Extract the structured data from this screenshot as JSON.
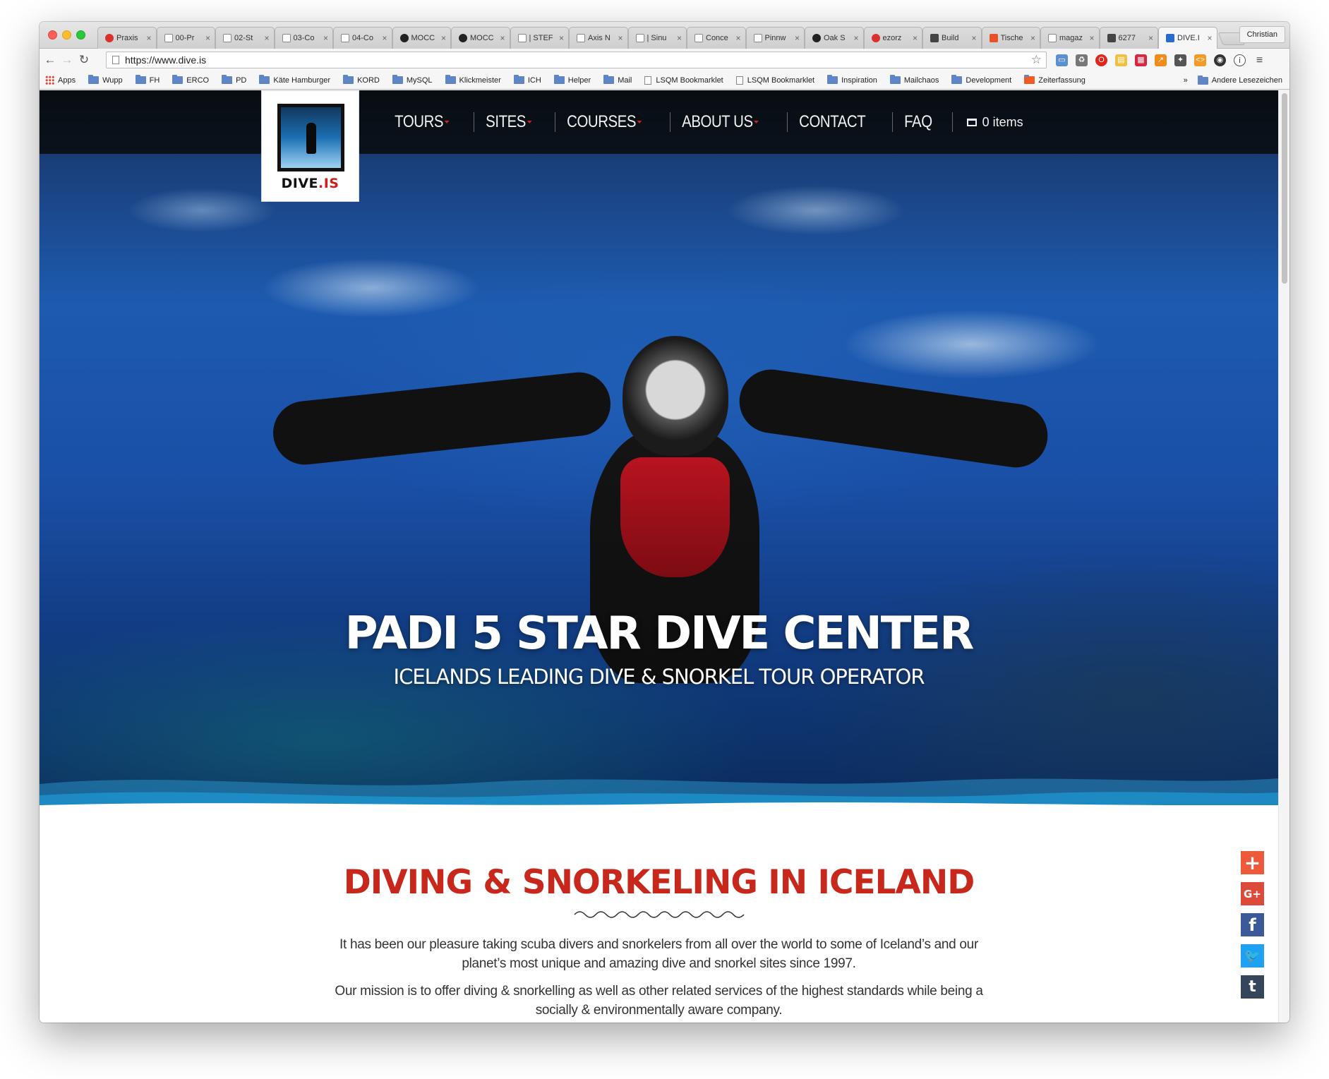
{
  "browser": {
    "tabs": [
      {
        "label": "Praxis",
        "icon": "pinterest-icon"
      },
      {
        "label": "00-Pr",
        "icon": "document-icon"
      },
      {
        "label": "02-St",
        "icon": "document-icon"
      },
      {
        "label": "03-Co",
        "icon": "document-icon"
      },
      {
        "label": "04-Co",
        "icon": "document-icon"
      },
      {
        "label": "MOCC",
        "icon": "circle-icon"
      },
      {
        "label": "MOCC",
        "icon": "circle-icon"
      },
      {
        "label": "| STEF",
        "icon": "document-icon"
      },
      {
        "label": "Axis N",
        "icon": "document-icon"
      },
      {
        "label": "| Sinu",
        "icon": "document-icon"
      },
      {
        "label": "Conce",
        "icon": "document-icon"
      },
      {
        "label": "Pinnw",
        "icon": "document-icon"
      },
      {
        "label": "Oak S",
        "icon": "o-icon"
      },
      {
        "label": "ezorz",
        "icon": "red-circle-icon"
      },
      {
        "label": "Build",
        "icon": "layers-icon"
      },
      {
        "label": "Tische",
        "icon": "orange-icon"
      },
      {
        "label": "magaz",
        "icon": "google-icon"
      },
      {
        "label": "6277",
        "icon": "dark-icon"
      },
      {
        "label": "DIVE.I",
        "icon": "dive-icon"
      }
    ],
    "profile_name": "Christian",
    "url": "https://www.dive.is",
    "bookmarks": [
      {
        "label": "Apps",
        "type": "apps"
      },
      {
        "label": "Wupp",
        "type": "folder"
      },
      {
        "label": "FH",
        "type": "folder"
      },
      {
        "label": "ERCO",
        "type": "folder"
      },
      {
        "label": "PD",
        "type": "folder"
      },
      {
        "label": "Käte Hamburger",
        "type": "folder"
      },
      {
        "label": "KORD",
        "type": "folder"
      },
      {
        "label": "MySQL",
        "type": "folder"
      },
      {
        "label": "Klickmeister",
        "type": "folder"
      },
      {
        "label": "ICH",
        "type": "folder"
      },
      {
        "label": "Helper",
        "type": "folder"
      },
      {
        "label": "Mail",
        "type": "folder"
      },
      {
        "label": "LSQM Bookmarklet",
        "type": "page"
      },
      {
        "label": "LSQM Bookmarklet",
        "type": "page"
      },
      {
        "label": "Inspiration",
        "type": "folder"
      },
      {
        "label": "Mailchaos",
        "type": "folder"
      },
      {
        "label": "Development",
        "type": "folder"
      },
      {
        "label": "Zeiterfassung",
        "type": "app"
      }
    ],
    "bookmarks_overflow": "»",
    "other_bookmarks": "Andere Lesezeichen"
  },
  "site": {
    "logo_text": "DIVE",
    "logo_suffix": ".IS",
    "nav": [
      {
        "label": "TOURS",
        "dropdown": true
      },
      {
        "label": "SITES",
        "dropdown": true
      },
      {
        "label": "COURSES",
        "dropdown": true
      },
      {
        "label": "ABOUT US",
        "dropdown": true
      },
      {
        "label": "CONTACT",
        "dropdown": false
      },
      {
        "label": "FAQ",
        "dropdown": false
      }
    ],
    "cart_label": "0 items",
    "hero_title": "PADI 5 STAR DIVE CENTER",
    "hero_subtitle": "ICELANDS LEADING DIVE & SNORKEL TOUR OPERATOR",
    "section_title": "DIVING & SNORKELING IN ICELAND",
    "paragraph_1": "It has been our pleasure taking scuba divers and snorkelers from all over the world to some of Iceland’s and our planet’s most unique and amazing dive and snorkel sites since 1997.",
    "paragraph_2": "Our mission is to offer diving & snorkelling as well as other related services of the highest standards while being a socially & environmentally aware company.",
    "share_buttons": [
      {
        "name": "add-share-icon",
        "glyph": "+"
      },
      {
        "name": "google-plus-icon",
        "glyph": "G+"
      },
      {
        "name": "facebook-icon",
        "glyph": "f"
      },
      {
        "name": "twitter-icon",
        "glyph": "🐦"
      },
      {
        "name": "tumblr-icon",
        "glyph": "t"
      }
    ]
  },
  "colors": {
    "brand_red": "#d01e1c",
    "heading_red": "#c8281c",
    "header_bg": "#080c10",
    "ocean_blue": "#1d5bb0"
  }
}
